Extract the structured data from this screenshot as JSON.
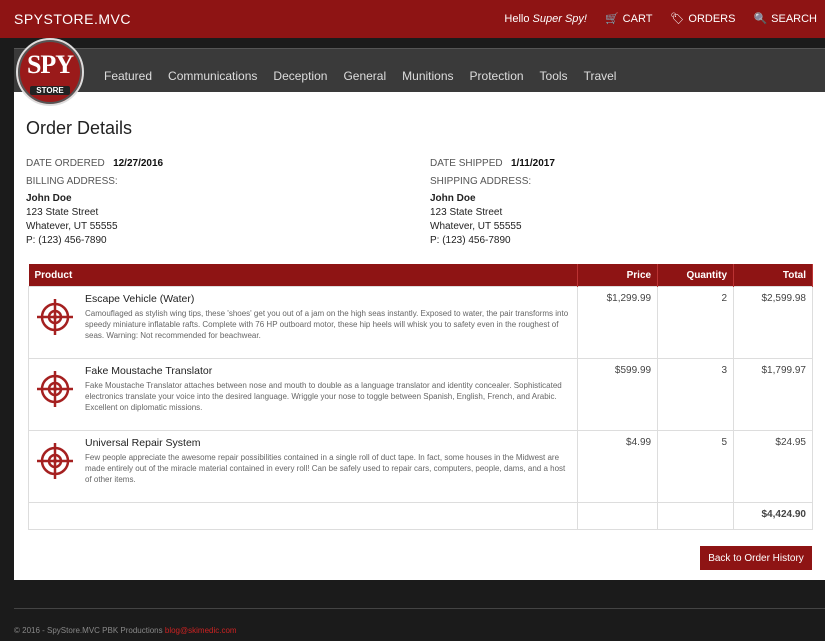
{
  "header": {
    "brand": "SPYSTORE.MVC",
    "greeting_prefix": "Hello",
    "user_name": "Super Spy!",
    "cart_label": "CART",
    "orders_label": "ORDERS",
    "search_label": "SEARCH"
  },
  "logo": {
    "line1": "SPY",
    "line2": "STORE"
  },
  "categories": [
    "Featured",
    "Communications",
    "Deception",
    "General",
    "Munitions",
    "Protection",
    "Tools",
    "Travel"
  ],
  "order": {
    "title": "Order Details",
    "date_ordered_label": "DATE ORDERED",
    "date_ordered": "12/27/2016",
    "date_shipped_label": "DATE SHIPPED",
    "date_shipped": "1/11/2017",
    "billing_label": "BILLING ADDRESS:",
    "shipping_label": "SHIPPING ADDRESS:",
    "billing": {
      "name": "John Doe",
      "street": "123 State Street",
      "city": "Whatever, UT 55555",
      "phone": "P: (123) 456-7890"
    },
    "shipping": {
      "name": "John Doe",
      "street": "123 State Street",
      "city": "Whatever, UT 55555",
      "phone": "P: (123) 456-7890"
    }
  },
  "table": {
    "columns": [
      "Product",
      "Price",
      "Quantity",
      "Total"
    ],
    "rows": [
      {
        "name": "Escape Vehicle (Water)",
        "description": "Camouflaged as stylish wing tips, these 'shoes' get you out of a jam on the high seas instantly. Exposed to water, the pair transforms into speedy miniature inflatable rafts. Complete with 76 HP outboard motor, these hip heels will whisk you to safety even in the roughest of seas. Warning: Not recommended for beachwear.",
        "price": "$1,299.99",
        "quantity": "2",
        "total": "$2,599.98"
      },
      {
        "name": "Fake Moustache Translator",
        "description": "Fake Moustache Translator attaches between nose and mouth to double as a language translator and identity concealer. Sophisticated electronics translate your voice into the desired language. Wriggle your nose to toggle between Spanish, English, French, and Arabic. Excellent on diplomatic missions.",
        "price": "$599.99",
        "quantity": "3",
        "total": "$1,799.97"
      },
      {
        "name": "Universal Repair System",
        "description": "Few people appreciate the awesome repair possibilities contained in a single roll of duct tape. In fact, some houses in the Midwest are made entirely out of the miracle material contained in every roll! Can be safely used to repair cars, computers, people, dams, and a host of other items.",
        "price": "$4.99",
        "quantity": "5",
        "total": "$24.95"
      }
    ],
    "grand_total": "$4,424.90"
  },
  "back_button": "Back to Order History",
  "footer": {
    "text": "© 2016 - SpyStore.MVC PBK Productions",
    "blog": "blog@skimedic.com"
  },
  "colors": {
    "brand_red": "#8e1414",
    "nav_dark": "#3a3a3a"
  }
}
